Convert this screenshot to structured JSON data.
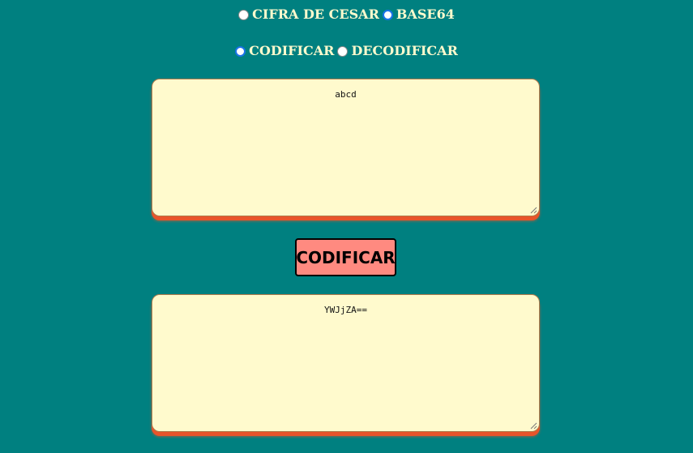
{
  "method_options": [
    {
      "label": "CIFRA DE CESAR",
      "checked": false
    },
    {
      "label": "BASE64",
      "checked": true
    }
  ],
  "mode_options": [
    {
      "label": "CODIFICAR",
      "checked": true
    },
    {
      "label": "DECODIFICAR",
      "checked": false
    }
  ],
  "input_text": "abcd",
  "action_button_label": "CODIFICAR",
  "output_text": "YWJjZA==",
  "colors": {
    "background": "#008080",
    "text_box": "#fffacd",
    "shadow": "#e8542a",
    "button": "#ff8a80",
    "radio_checked": "#1a73e8"
  }
}
